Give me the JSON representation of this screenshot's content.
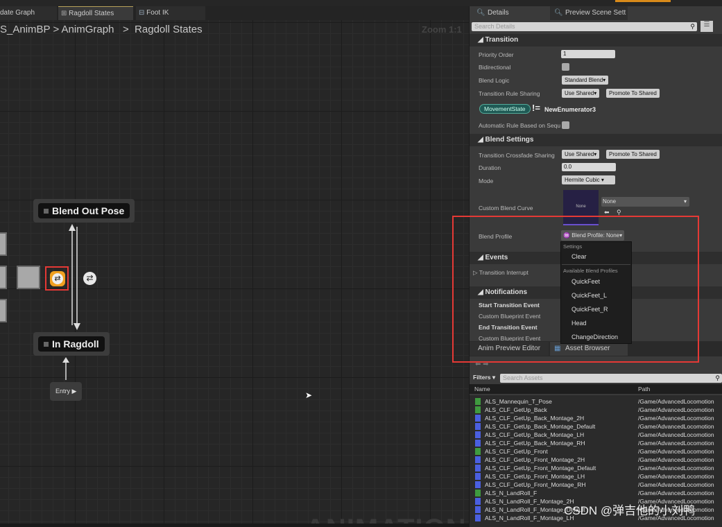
{
  "editor_tabs": [
    {
      "label": "date Graph"
    },
    {
      "label": "Ragdoll States",
      "active": true
    },
    {
      "label": "Foot IK"
    }
  ],
  "breadcrumb": {
    "root": "S_AnimBP",
    "sep": ">",
    "mid": "AnimGraph",
    "leaf": "Ragdoll States"
  },
  "zoom": "Zoom 1:1",
  "graph": {
    "states": [
      {
        "label": "Blend Out Pose"
      },
      {
        "label": "In Ragdoll"
      }
    ],
    "entry": "Entry",
    "watermark": "ANIMATION"
  },
  "details": {
    "tabs": [
      {
        "label": "Details"
      },
      {
        "label": "Preview Scene Sett"
      }
    ],
    "search_placeholder": "Search Details",
    "transition": {
      "title": "Transition",
      "priority_label": "Priority Order",
      "priority_value": "1",
      "bidirectional_label": "Bidirectional",
      "blend_logic_label": "Blend Logic",
      "blend_logic_value": "Standard Blend",
      "rule_sharing_label": "Transition Rule Sharing",
      "use_shared": "Use Shared",
      "promote": "Promote To Shared",
      "var_pill": "MovementState",
      "not_equal": "!=",
      "enum_value": "NewEnumerator3",
      "auto_rule_label": "Automatic Rule Based on Sequ"
    },
    "blend": {
      "title": "Blend Settings",
      "crossfade_label": "Transition Crossfade Sharing",
      "use_shared": "Use Shared",
      "promote": "Promote To Shared",
      "duration_label": "Duration",
      "duration_value": "0.0",
      "mode_label": "Mode",
      "mode_value": "Hermite Cubic",
      "curve_label": "Custom Blend Curve",
      "curve_thumb": "None",
      "curve_value": "None",
      "profile_label": "Blend Profile",
      "profile_value": "Blend Profile: None"
    },
    "events": {
      "title": "Events",
      "interrupt": "Transition Interrupt"
    },
    "notifications": {
      "title": "Notifications",
      "start": "Start Transition Event",
      "custom1": "Custom Blueprint Event",
      "end": "End Transition Event",
      "custom2": "Custom Blueprint Event"
    }
  },
  "dropdown": {
    "settings_header": "Settings",
    "clear": "Clear",
    "profiles_header": "Available Blend Profiles",
    "items": [
      "QuickFeet",
      "QuickFeet_L",
      "QuickFeet_R",
      "Head",
      "ChangeDirection"
    ]
  },
  "bottom_tabs": [
    {
      "label": "Anim Preview Editor"
    },
    {
      "label": "Asset Browser"
    }
  ],
  "assets": {
    "filters": "Filters",
    "search_placeholder": "Search Assets",
    "col_name": "Name",
    "col_path": "Path",
    "colors": {
      "animation": "#3f9a3f",
      "montage": "#4a5fe0"
    },
    "rows": [
      {
        "name": "ALS_Mannequin_T_Pose",
        "path": "/Game/AdvancedLocomotion",
        "type": "animation"
      },
      {
        "name": "ALS_CLF_GetUp_Back",
        "path": "/Game/AdvancedLocomotion",
        "type": "animation"
      },
      {
        "name": "ALS_CLF_GetUp_Back_Montage_2H",
        "path": "/Game/AdvancedLocomotion",
        "type": "montage"
      },
      {
        "name": "ALS_CLF_GetUp_Back_Montage_Default",
        "path": "/Game/AdvancedLocomotion",
        "type": "montage"
      },
      {
        "name": "ALS_CLF_GetUp_Back_Montage_LH",
        "path": "/Game/AdvancedLocomotion",
        "type": "montage"
      },
      {
        "name": "ALS_CLF_GetUp_Back_Montage_RH",
        "path": "/Game/AdvancedLocomotion",
        "type": "montage"
      },
      {
        "name": "ALS_CLF_GetUp_Front",
        "path": "/Game/AdvancedLocomotion",
        "type": "animation"
      },
      {
        "name": "ALS_CLF_GetUp_Front_Montage_2H",
        "path": "/Game/AdvancedLocomotion",
        "type": "montage"
      },
      {
        "name": "ALS_CLF_GetUp_Front_Montage_Default",
        "path": "/Game/AdvancedLocomotion",
        "type": "montage"
      },
      {
        "name": "ALS_CLF_GetUp_Front_Montage_LH",
        "path": "/Game/AdvancedLocomotion",
        "type": "montage"
      },
      {
        "name": "ALS_CLF_GetUp_Front_Montage_RH",
        "path": "/Game/AdvancedLocomotion",
        "type": "montage"
      },
      {
        "name": "ALS_N_LandRoll_F",
        "path": "/Game/AdvancedLocomotion",
        "type": "animation"
      },
      {
        "name": "ALS_N_LandRoll_F_Montage_2H",
        "path": "/Game/AdvancedLocomotion",
        "type": "montage"
      },
      {
        "name": "ALS_N_LandRoll_F_Montage_Default",
        "path": "/Game/AdvancedLocomotion",
        "type": "montage"
      },
      {
        "name": "ALS_N_LandRoll_F_Montage_LH",
        "path": "/Game/AdvancedLocomotion",
        "type": "montage"
      }
    ]
  },
  "watermark_text": "CSDN @弹吉他的小刘鸭"
}
